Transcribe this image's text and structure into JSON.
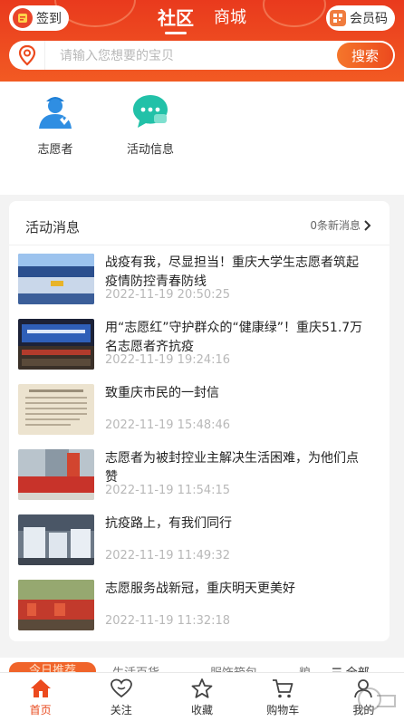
{
  "header": {
    "signin_label": "签到",
    "tabs": [
      {
        "label": "社区",
        "active": true
      },
      {
        "label": "商城",
        "active": false
      }
    ],
    "member_label": "会员码",
    "search_placeholder": "请输入您想要的宝贝",
    "search_button": "搜索"
  },
  "shortcuts": [
    {
      "label": "志愿者",
      "icon": "volunteer-icon"
    },
    {
      "label": "活动信息",
      "icon": "chat-bubble-icon"
    }
  ],
  "news": {
    "heading": "活动消息",
    "new_count_label": "0条新消息",
    "items": [
      {
        "title": "战疫有我，尽显担当！重庆大学生志愿者筑起疫情防控青春防线",
        "time": "2022-11-19 20:50:25"
      },
      {
        "title": "用“志愿红”守护群众的“健康绿”！重庆51.7万名志愿者齐抗疫",
        "time": "2022-11-19 19:24:16"
      },
      {
        "title": "致重庆市民的一封信",
        "time": "2022-11-19 15:48:46"
      },
      {
        "title": "志愿者为被封控业主解决生活困难，为他们点赞",
        "time": "2022-11-19 11:54:15"
      },
      {
        "title": "抗疫路上，有我们同行",
        "time": "2022-11-19 11:49:32"
      },
      {
        "title": "志愿服务战新冠，重庆明天更美好",
        "time": "2022-11-19 11:32:18"
      }
    ]
  },
  "categories": {
    "items": [
      "今日推荐",
      "生活百货",
      "服饰箱包",
      "粮"
    ],
    "all_label": "全部"
  },
  "bottom_nav": [
    {
      "label": "首页",
      "icon": "home-icon",
      "active": true
    },
    {
      "label": "关注",
      "icon": "heart-icon",
      "active": false
    },
    {
      "label": "收藏",
      "icon": "star-icon",
      "active": false
    },
    {
      "label": "购物车",
      "icon": "cart-icon",
      "active": false
    },
    {
      "label": "我的",
      "icon": "profile-icon",
      "active": false
    }
  ],
  "colors": {
    "brand": "#ec4a1e",
    "header_bg": "#e93a1d",
    "time_text": "#b8b8b8"
  }
}
